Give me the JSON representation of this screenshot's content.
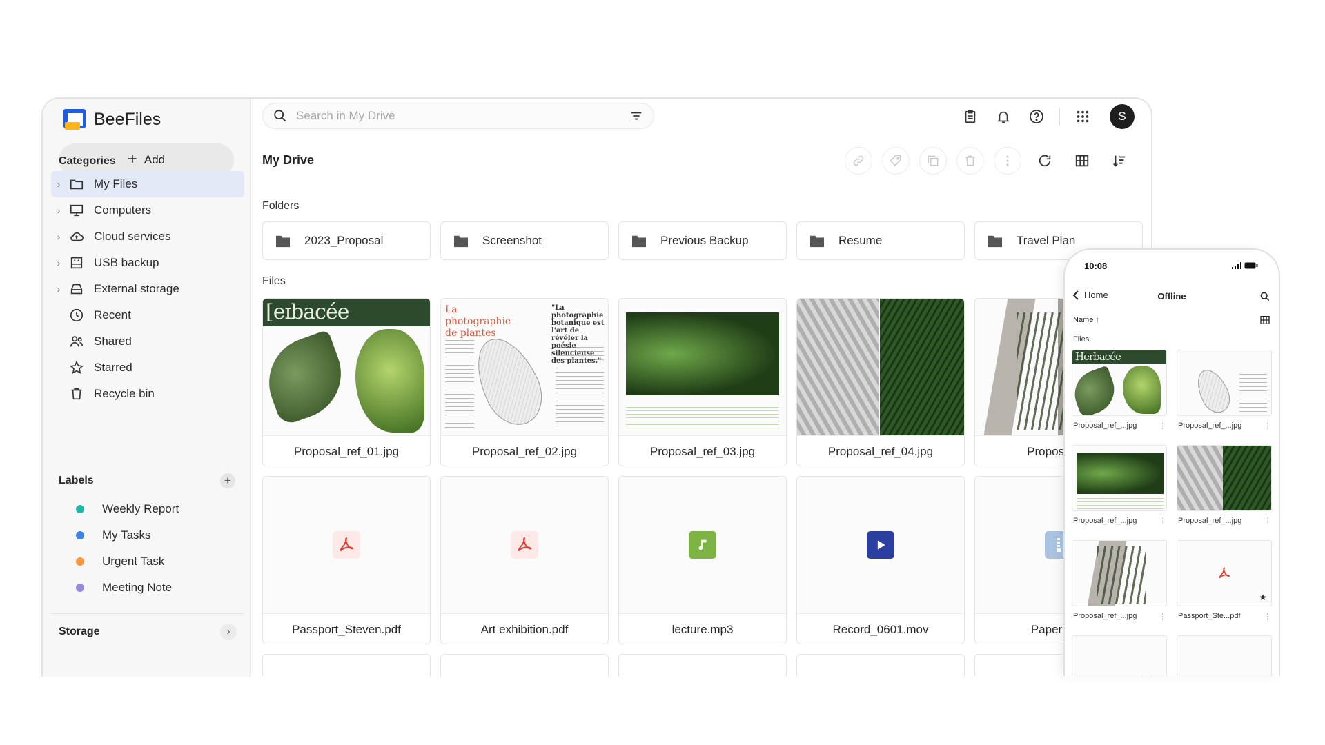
{
  "app": {
    "name": "BeeFiles"
  },
  "sidebar": {
    "add_label": "Add",
    "categories_title": "Categories",
    "categories": [
      {
        "label": "My Files",
        "icon": "folder-icon",
        "expandable": true,
        "active": true
      },
      {
        "label": "Computers",
        "icon": "monitor-icon",
        "expandable": true
      },
      {
        "label": "Cloud services",
        "icon": "cloud-icon",
        "expandable": true
      },
      {
        "label": "USB backup",
        "icon": "usb-drive-icon",
        "expandable": true
      },
      {
        "label": "External storage",
        "icon": "hard-drive-icon",
        "expandable": true
      },
      {
        "label": "Recent",
        "icon": "clock-icon",
        "expandable": false
      },
      {
        "label": "Shared",
        "icon": "people-icon",
        "expandable": false
      },
      {
        "label": "Starred",
        "icon": "star-icon",
        "expandable": false
      },
      {
        "label": "Recycle bin",
        "icon": "trash-icon",
        "expandable": false
      }
    ],
    "labels_title": "Labels",
    "labels": [
      {
        "label": "Weekly Report",
        "color": "#1fb5a9"
      },
      {
        "label": "My Tasks",
        "color": "#3f82e6"
      },
      {
        "label": "Urgent Task",
        "color": "#f59a3c"
      },
      {
        "label": "Meeting Note",
        "color": "#9a86dc"
      }
    ],
    "storage_title": "Storage"
  },
  "header": {
    "search_placeholder": "Search in My Drive",
    "avatar_initial": "S"
  },
  "main": {
    "title": "My Drive",
    "folders_title": "Folders",
    "files_title": "Files",
    "folders": [
      "2023_Proposal",
      "Screenshot",
      "Previous Backup",
      "Resume",
      "Travel Plan"
    ],
    "thumb_text": {
      "herbacee": "[eɪbacée",
      "photo_title": "La photographie de plantes",
      "photo_quote": "\"La photographie botanique est l'art de révéler la poésie silencieuse des plantes.\""
    },
    "files": [
      {
        "name": "Proposal_ref_01.jpg",
        "kind": "image"
      },
      {
        "name": "Proposal_ref_02.jpg",
        "kind": "image"
      },
      {
        "name": "Proposal_ref_03.jpg",
        "kind": "image"
      },
      {
        "name": "Proposal_ref_04.jpg",
        "kind": "image"
      },
      {
        "name": "Proposal_re",
        "kind": "image"
      },
      {
        "name": "Passport_Steven.pdf",
        "kind": "pdf",
        "icon": "pdf-icon",
        "color": "#e23b2e"
      },
      {
        "name": "Art exhibition.pdf",
        "kind": "pdf",
        "icon": "pdf-icon",
        "color": "#e23b2e"
      },
      {
        "name": "lecture.mp3",
        "kind": "audio",
        "icon": "music-note-icon",
        "color": "#7cb342"
      },
      {
        "name": "Record_0601.mov",
        "kind": "video",
        "icon": "play-icon",
        "color": "#2b3fa0"
      },
      {
        "name": "Paper Sub",
        "kind": "archive",
        "icon": "zip-icon",
        "color": "#a9c3e0"
      }
    ]
  },
  "phone": {
    "time": "10:08",
    "back_label": "Home",
    "title": "Offline",
    "sort_label": "Name ↑",
    "files_title": "Files",
    "thumb_text": "Herbacée",
    "files": [
      {
        "name": "Proposal_ref_...jpg"
      },
      {
        "name": "Proposal_ref_...jpg"
      },
      {
        "name": "Proposal_ref_...jpg"
      },
      {
        "name": "Proposal_ref_...jpg"
      },
      {
        "name": "Proposal_ref_...jpg"
      },
      {
        "name": "Passport_Ste...pdf"
      }
    ]
  }
}
